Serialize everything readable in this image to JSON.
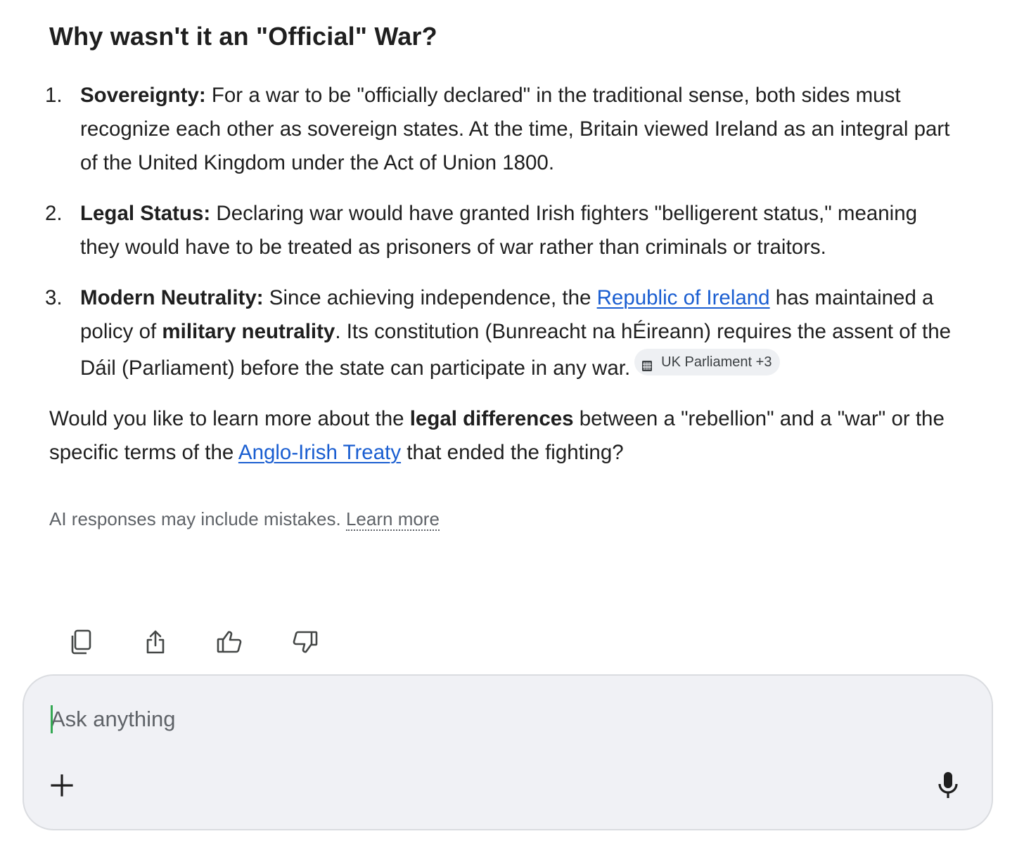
{
  "heading": "Why wasn't it an \"Official\" War?",
  "points": [
    {
      "number": "1.",
      "label": "Sovereignty:",
      "text": " For a war to be \"officially declared\" in the traditional sense, both sides must recognize each other as sovereign states. At the time, Britain viewed Ireland as an integral part of the United Kingdom under the Act of Union 1800."
    },
    {
      "number": "2.",
      "label": "Legal Status:",
      "text": " Declaring war would have granted Irish fighters \"belligerent status,\" meaning they would have to be treated as prisoners of war rather than criminals or traitors."
    },
    {
      "number": "3.",
      "label": "Modern Neutrality:",
      "text_before_link": " Since achieving independence, the ",
      "link": "Republic of Ireland",
      "text_after_link": " has maintained a policy of ",
      "bold": "military neutrality",
      "text_end": ". Its constitution (Bunreacht na hÉireann) requires the assent of the Dáil (Parliament) before the state can participate in any war.",
      "source_chip": "UK Parliament +3",
      "source_chip_icon": "parliament-icon"
    }
  ],
  "followup": {
    "text_before_bold": "Would you like to learn more about the ",
    "bold": "legal differences",
    "text_before_link": " between a \"rebellion\" and a \"war\" or the specific terms of the ",
    "link": "Anglo-Irish Treaty",
    "text_end": " that ended the fighting?"
  },
  "disclaimer": {
    "text": "AI responses may include mistakes. ",
    "learn_more": "Learn more"
  },
  "actions": [
    {
      "name": "copy-icon"
    },
    {
      "name": "share-icon"
    },
    {
      "name": "thumbs-up-icon"
    },
    {
      "name": "thumbs-down-icon"
    }
  ],
  "composer": {
    "placeholder": "Ask anything",
    "value": "",
    "add_icon": "plus-icon",
    "mic_icon": "microphone-icon"
  },
  "colors": {
    "link": "#1a5ed1",
    "composer_bg": "#f0f1f5",
    "caret": "#34a853",
    "muted_text": "#5f6368"
  }
}
